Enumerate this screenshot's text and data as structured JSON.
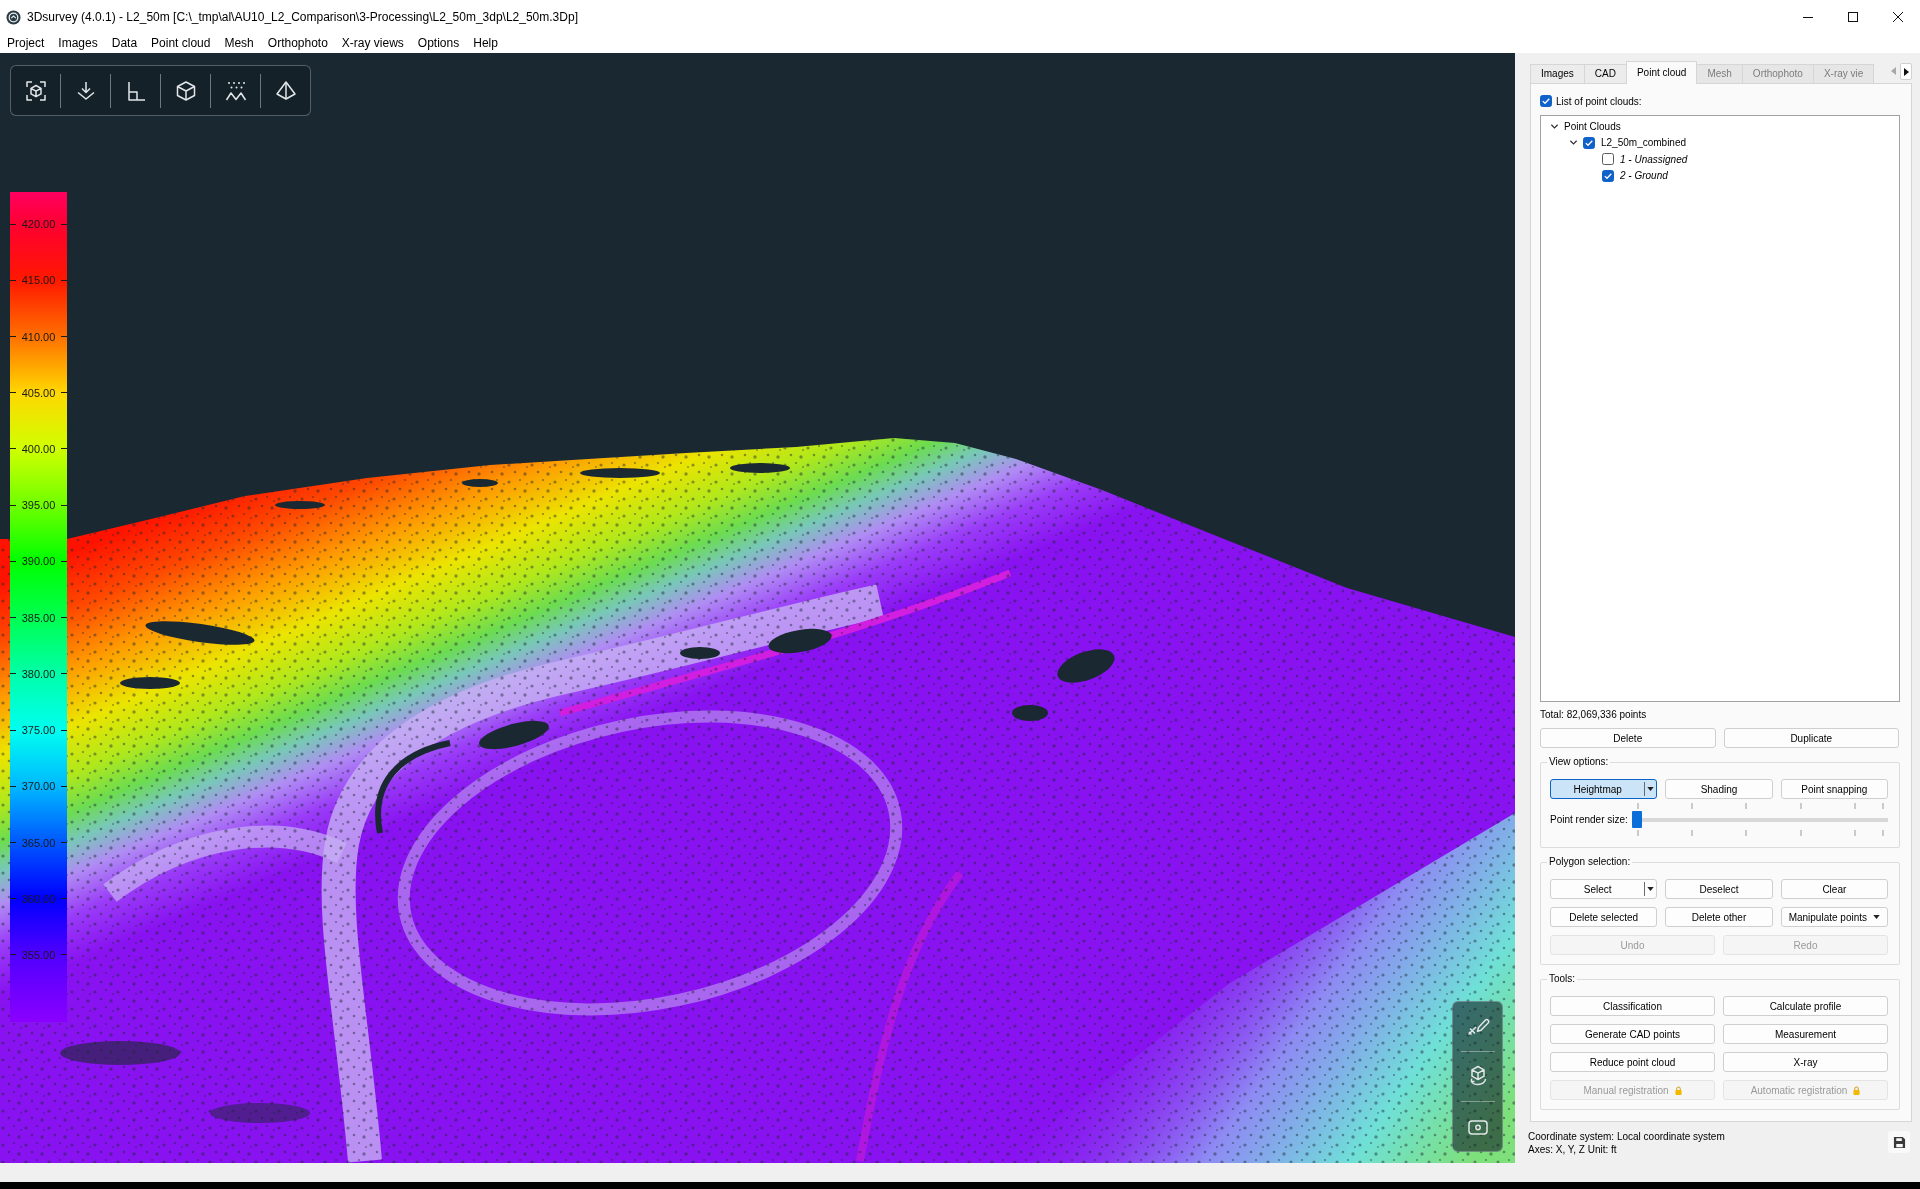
{
  "window": {
    "title": "3Dsurvey (4.0.1) - L2_50m [C:\\_tmp\\al\\AU10_L2_Comparison\\3-Processing\\L2_50m_3dp\\L2_50m.3Dp]"
  },
  "menu": [
    "Project",
    "Images",
    "Data",
    "Point cloud",
    "Mesh",
    "Orthophoto",
    "X-ray views",
    "Options",
    "Help"
  ],
  "legend": {
    "ticks": [
      "420.00",
      "415.00",
      "410.00",
      "405.00",
      "400.00",
      "395.00",
      "390.00",
      "385.00",
      "380.00",
      "375.00",
      "370.00",
      "365.00",
      "360.00",
      "355.00"
    ]
  },
  "panel": {
    "tabs": [
      {
        "label": "Images",
        "selected": false,
        "disabled": false
      },
      {
        "label": "CAD",
        "selected": false,
        "disabled": false
      },
      {
        "label": "Point cloud",
        "selected": true,
        "disabled": false
      },
      {
        "label": "Mesh",
        "selected": false,
        "disabled": true
      },
      {
        "label": "Orthophoto",
        "selected": false,
        "disabled": true
      },
      {
        "label": "X-ray vie",
        "selected": false,
        "disabled": true
      }
    ],
    "tab_scroll": {
      "back_disabled": true,
      "forward_disabled": false
    },
    "list_toggle": {
      "label": "List of point clouds:",
      "checked": true
    },
    "tree": [
      {
        "kind": "folder",
        "label": "Point Clouds",
        "expanded": true,
        "children": [
          {
            "kind": "cloud",
            "label": "L2_50m_combined",
            "expanded": true,
            "checked": true,
            "children": [
              {
                "kind": "class",
                "label": "1 - Unassigned",
                "checked": false
              },
              {
                "kind": "class",
                "label": "2 - Ground",
                "checked": true
              }
            ]
          }
        ]
      }
    ],
    "total": "Total: 82,069,336 points",
    "actions": [
      {
        "label": "Delete",
        "kind": "plain",
        "disabled": false
      },
      {
        "label": "Duplicate",
        "kind": "plain",
        "disabled": false
      }
    ],
    "groups": [
      {
        "title": "View options:",
        "rows": [
          {
            "kind": "buttons",
            "buttons": [
              {
                "label": "Heightmap",
                "kind": "split",
                "selected": true,
                "disabled": false
              },
              {
                "label": "Shading",
                "kind": "plain",
                "selected": false,
                "disabled": false
              },
              {
                "label": "Point snapping",
                "kind": "plain",
                "selected": false,
                "disabled": false
              }
            ]
          },
          {
            "kind": "slider",
            "label": "Point render size:",
            "level": 0
          }
        ]
      },
      {
        "title": "Polygon selection:",
        "rows": [
          {
            "kind": "buttons",
            "buttons": [
              {
                "label": "Select",
                "kind": "split",
                "disabled": false
              },
              {
                "label": "Deselect",
                "kind": "plain",
                "disabled": false
              },
              {
                "label": "Clear",
                "kind": "plain",
                "disabled": false
              }
            ]
          },
          {
            "kind": "buttons",
            "buttons": [
              {
                "label": "Delete selected",
                "kind": "plain",
                "disabled": false
              },
              {
                "label": "Delete other",
                "kind": "plain",
                "disabled": false
              },
              {
                "label": "Manipulate points",
                "kind": "menu",
                "disabled": false
              }
            ]
          },
          {
            "kind": "buttons",
            "buttons": [
              {
                "label": "Undo",
                "kind": "plain",
                "disabled": true
              },
              {
                "label": "Redo",
                "kind": "plain",
                "disabled": true
              }
            ]
          }
        ]
      },
      {
        "title": "Tools:",
        "rows": [
          {
            "kind": "buttons",
            "buttons": [
              {
                "label": "Classification",
                "kind": "plain",
                "disabled": false,
                "locked": false
              },
              {
                "label": "Calculate profile",
                "kind": "plain",
                "disabled": false,
                "locked": false
              }
            ]
          },
          {
            "kind": "buttons",
            "buttons": [
              {
                "label": "Generate CAD points",
                "kind": "plain",
                "disabled": false,
                "locked": false
              },
              {
                "label": "Measurement",
                "kind": "plain",
                "disabled": false,
                "locked": false
              }
            ]
          },
          {
            "kind": "buttons",
            "buttons": [
              {
                "label": "Reduce point cloud",
                "kind": "plain",
                "disabled": false,
                "locked": false
              },
              {
                "label": "X-ray",
                "kind": "plain",
                "disabled": false,
                "locked": false
              }
            ]
          },
          {
            "kind": "buttons",
            "buttons": [
              {
                "label": "Manual registration",
                "kind": "plain",
                "disabled": true,
                "locked": true
              },
              {
                "label": "Automatic registration",
                "kind": "plain",
                "disabled": true,
                "locked": true
              }
            ]
          }
        ]
      }
    ],
    "footer": {
      "coordinate_system": "Coordinate system: Local coordinate system",
      "axes": "Axes: X, Y, Z Unit: ft"
    }
  }
}
